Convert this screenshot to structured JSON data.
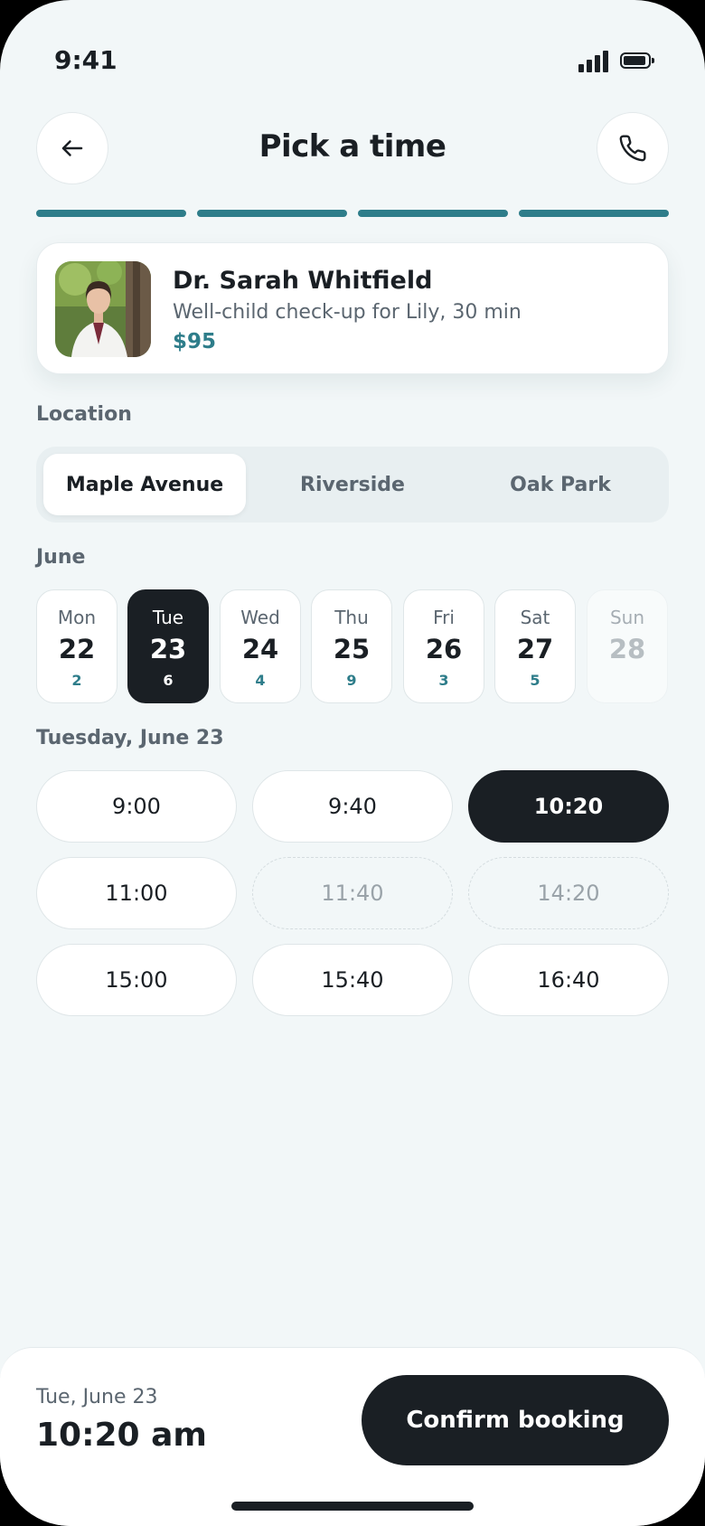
{
  "status_bar": {
    "time": "9:41"
  },
  "header": {
    "title": "Pick a time",
    "back_icon": "arrow-left-icon",
    "call_icon": "phone-icon"
  },
  "progress": {
    "steps_total": 4,
    "steps_completed": 4,
    "color": "#2e7d8a"
  },
  "doctor": {
    "name": "Dr. Sarah Whitfield",
    "description": "Well-child check-up for Lily, 30 min",
    "price": "$95"
  },
  "location": {
    "label": "Location",
    "options": [
      "Maple Avenue",
      "Riverside",
      "Oak Park"
    ],
    "selected": "Maple Avenue"
  },
  "calendar": {
    "month": "June",
    "days": [
      {
        "name": "Mon",
        "num": "22",
        "count": "2"
      },
      {
        "name": "Tue",
        "num": "23",
        "count": "6"
      },
      {
        "name": "Wed",
        "num": "24",
        "count": "4"
      },
      {
        "name": "Thu",
        "num": "25",
        "count": "9"
      },
      {
        "name": "Fri",
        "num": "26",
        "count": "3"
      },
      {
        "name": "Sat",
        "num": "27",
        "count": "5"
      },
      {
        "name": "Sun",
        "num": "28",
        "count": ""
      }
    ],
    "selected_day": "23"
  },
  "slots": {
    "heading": "Tuesday, June 23",
    "times": [
      "9:00",
      "9:40",
      "10:20",
      "11:00",
      "11:40",
      "14:20",
      "15:00",
      "15:40",
      "16:40"
    ],
    "selected": "10:20",
    "unavailable": [
      "11:40",
      "14:20"
    ]
  },
  "summary": {
    "date": "Tue, June 23",
    "time": "10:20 am",
    "confirm_label": "Confirm booking"
  },
  "colors": {
    "accent": "#2e7d8a",
    "dark": "#1a1f24",
    "background": "#f2f7f8"
  }
}
